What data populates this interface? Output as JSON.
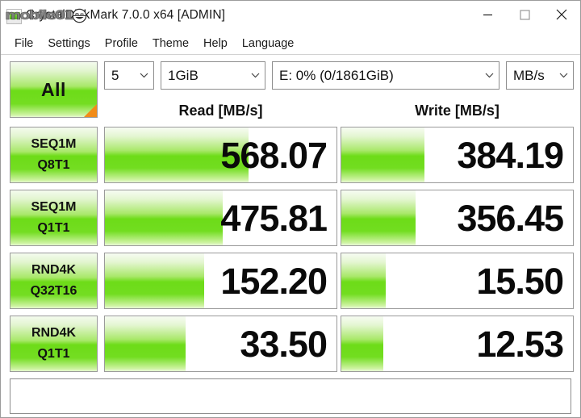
{
  "window": {
    "title": "CrystalDiskMark 7.0.0 x64 [ADMIN]",
    "watermark": "mobile01",
    "app_icon": "crystaldiskmark-icon",
    "controls": {
      "minimize": "minimize-icon",
      "maximize": "maximize-icon",
      "close": "close-icon"
    }
  },
  "menubar": {
    "items": [
      {
        "label": "File"
      },
      {
        "label": "Settings"
      },
      {
        "label": "Profile"
      },
      {
        "label": "Theme"
      },
      {
        "label": "Help"
      },
      {
        "label": "Language"
      }
    ]
  },
  "toolbar": {
    "all_button": "All",
    "test_count": "5",
    "test_size": "1GiB",
    "target_drive": "E: 0% (0/1861GiB)",
    "unit": "MB/s",
    "chevron": "chevron-down-icon"
  },
  "headers": {
    "read": "Read [MB/s]",
    "write": "Write [MB/s]"
  },
  "status": {
    "text": ""
  },
  "colors": {
    "bar_green": "#6ddc18",
    "bar_green_light": "#a9e86a",
    "corner_orange": "#f28c18",
    "border": "#9a9a9a"
  },
  "chart_data": {
    "type": "bar",
    "title": "CrystalDiskMark 7.0.0 x64 [ADMIN]",
    "unit": "MB/s",
    "xlabel": "",
    "ylabel": "",
    "categories": [
      "SEQ1M Q8T1",
      "SEQ1M Q1T1",
      "RND4K Q32T16",
      "RND4K Q1T1"
    ],
    "series": [
      {
        "name": "Read [MB/s]",
        "values": [
          568.07,
          475.81,
          152.2,
          33.5
        ]
      },
      {
        "name": "Write [MB/s]",
        "values": [
          384.19,
          356.45,
          15.5,
          12.53
        ]
      }
    ],
    "legend": [
      "Read [MB/s]",
      "Write [MB/s]"
    ],
    "grid": false
  },
  "rows": [
    {
      "label_line1": "SEQ1M",
      "label_line2": "Q8T1",
      "read": {
        "value": "568.07",
        "fill_pct": 62
      },
      "write": {
        "value": "384.19",
        "fill_pct": 36
      }
    },
    {
      "label_line1": "SEQ1M",
      "label_line2": "Q1T1",
      "read": {
        "value": "475.81",
        "fill_pct": 51
      },
      "write": {
        "value": "356.45",
        "fill_pct": 32
      }
    },
    {
      "label_line1": "RND4K",
      "label_line2": "Q32T16",
      "read": {
        "value": "152.20",
        "fill_pct": 43
      },
      "write": {
        "value": "15.50",
        "fill_pct": 19
      }
    },
    {
      "label_line1": "RND4K",
      "label_line2": "Q1T1",
      "read": {
        "value": "33.50",
        "fill_pct": 35
      },
      "write": {
        "value": "12.53",
        "fill_pct": 18
      }
    }
  ]
}
